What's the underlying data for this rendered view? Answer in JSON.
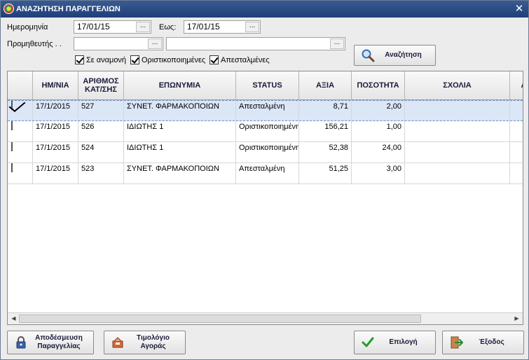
{
  "window": {
    "title": "ΑΝΑΖΗΤΗΣΗ ΠΑΡΑΓΓΕΛΙΩΝ",
    "close_glyph": "✕"
  },
  "filters": {
    "date_label": "Ημερομηνία",
    "date_from": "17/01/15",
    "to_label": "Εως:",
    "date_to": "17/01/15",
    "supplier_label": "Προμηθευτής . .",
    "supplier_code": "",
    "supplier_name": "",
    "dots": "...",
    "checks": [
      {
        "label": "Σε αναμονή",
        "checked": true
      },
      {
        "label": "Οριστικοποιημένες",
        "checked": true
      },
      {
        "label": "Απεσταλμένες",
        "checked": true
      }
    ],
    "search_label": "Αναζήτηση"
  },
  "grid": {
    "columns": [
      "",
      "ΗΜ/ΝΙΑ",
      "ΑΡΙΘΜΟΣ ΚΑΤ/ΣΗΣ",
      "ΕΠΩΝΥΜΙΑ",
      "STATUS",
      "ΑΞΙΑ",
      "ΠΟΣΟΤΗΤΑ",
      "ΣΧΟΛΙΑ",
      "Α"
    ],
    "rows": [
      {
        "checked": true,
        "selected": true,
        "date": "17/1/2015",
        "number": "527",
        "name": "ΣΥΝΕΤ. ΦΑΡΜΑΚΟΠΟΙΩΝ",
        "status": "Απεσταλμένη",
        "value": "8,71",
        "qty": "2,00",
        "notes": ""
      },
      {
        "checked": false,
        "selected": false,
        "date": "17/1/2015",
        "number": "526",
        "name": "ΙΔΙΩΤΗΣ 1",
        "status": "Οριστικοποιημένη",
        "value": "156,21",
        "qty": "1,00",
        "notes": ""
      },
      {
        "checked": false,
        "selected": false,
        "date": "17/1/2015",
        "number": "524",
        "name": "ΙΔΙΩΤΗΣ 1",
        "status": "Οριστικοποιημένη",
        "value": "52,38",
        "qty": "24,00",
        "notes": ""
      },
      {
        "checked": false,
        "selected": false,
        "date": "17/1/2015",
        "number": "523",
        "name": "ΣΥΝΕΤ. ΦΑΡΜΑΚΟΠΟΙΩΝ",
        "status": "Απεσταλμένη",
        "value": "51,25",
        "qty": "3,00",
        "notes": ""
      }
    ]
  },
  "scrollbar": {
    "left_arrow": "◀",
    "right_arrow": "▶"
  },
  "footer": {
    "release_label": "Αποδέσμευση Παραγγελίας",
    "invoice_label": "Τιμολόγιο Αγοράς",
    "select_label": "Επιλογή",
    "exit_label": "Έξοδος"
  },
  "colors": {
    "title_bar": "#1e3f7a",
    "selected_row": "#dbe6f6",
    "accept_green": "#2a9a2a",
    "exit_red": "#c0392b"
  },
  "icons": [
    "app-icon",
    "search-icon",
    "lock-icon",
    "invoice-icon",
    "checkmark-icon",
    "exit-door-icon"
  ]
}
